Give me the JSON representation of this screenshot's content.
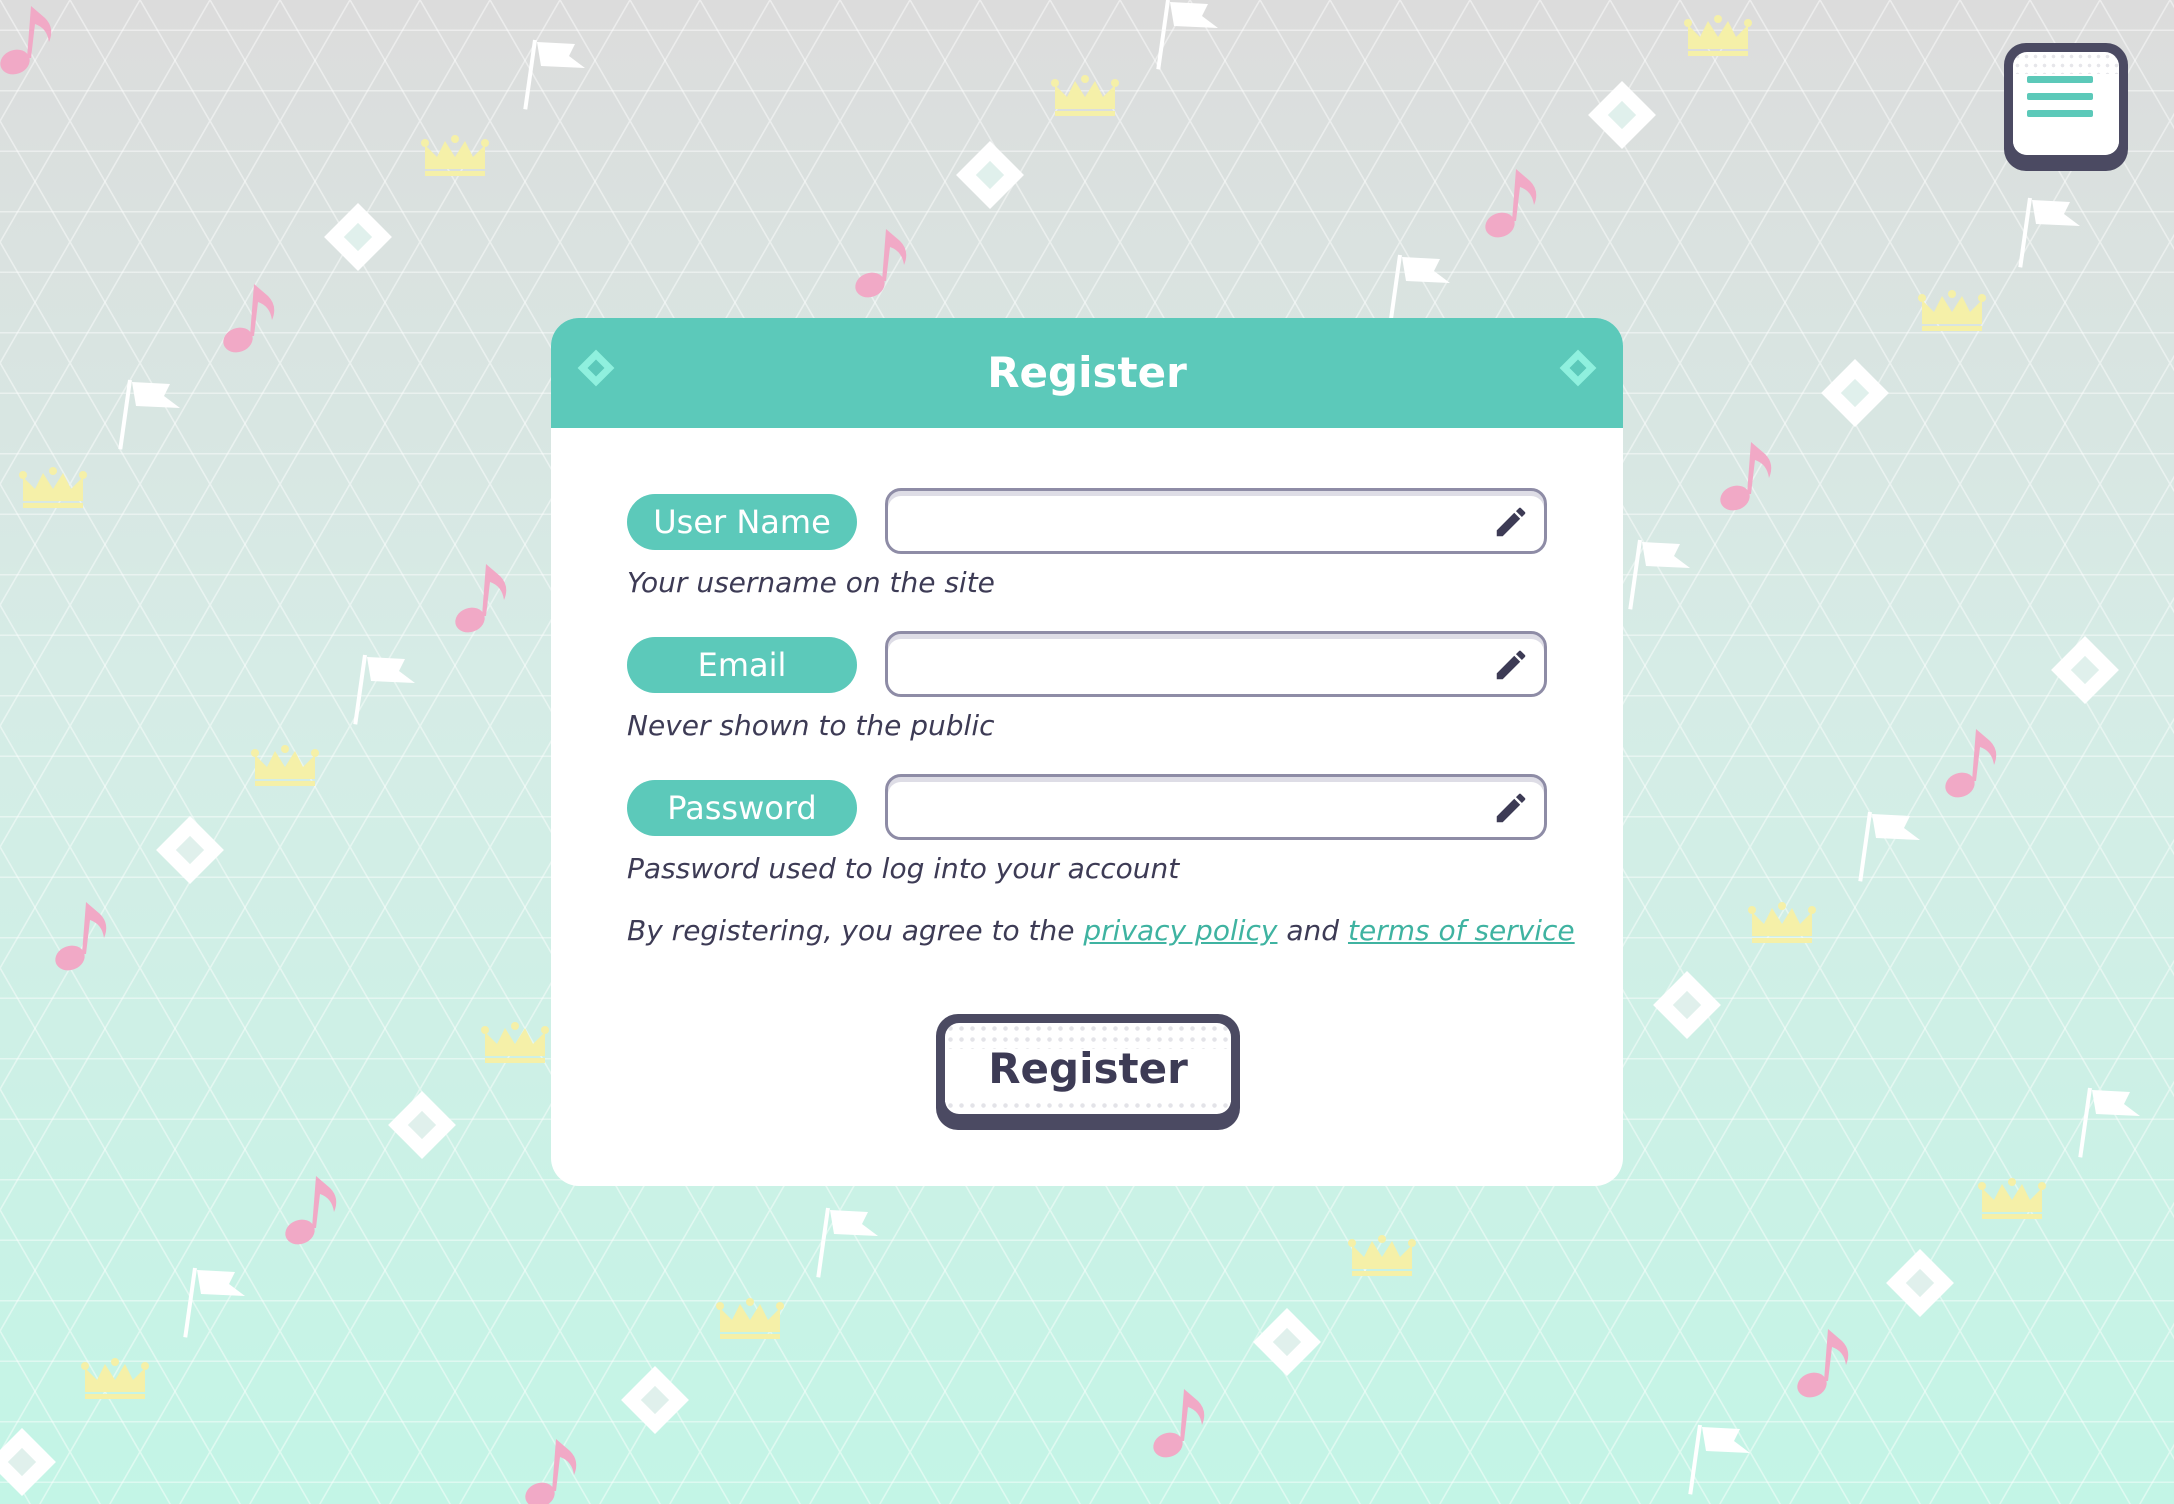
{
  "menu": {
    "icon": "hamburger-menu-icon"
  },
  "card": {
    "title": "Register",
    "fields": [
      {
        "label": "User Name",
        "value": "",
        "hint": "Your username on the site",
        "icon": "pencil-icon"
      },
      {
        "label": "Email",
        "value": "",
        "hint": "Never shown to the public",
        "icon": "pencil-icon"
      },
      {
        "label": "Password",
        "value": "",
        "hint": "Password used to log into your account",
        "icon": "pencil-icon"
      }
    ],
    "agreement": {
      "prefix": "By registering, you agree to the",
      "privacy_link": "privacy policy",
      "conjunction": "and",
      "terms_link": "terms of service"
    },
    "submit_label": "Register"
  },
  "colors": {
    "accent": "#5cc9ba",
    "dark": "#4b4a62",
    "link": "#3fb3a1",
    "text": "#3d3b55"
  }
}
